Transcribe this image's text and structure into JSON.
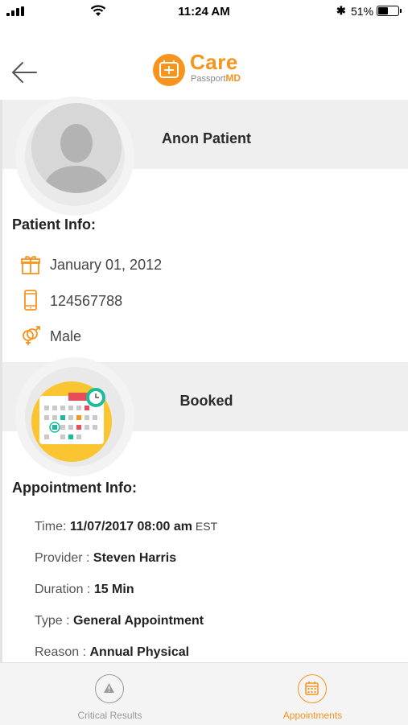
{
  "status_bar": {
    "time": "11:24 AM",
    "battery_percent": "51%",
    "battery_level": 0.51
  },
  "header": {
    "back_icon": "arrow-left-icon",
    "logo": {
      "word": "Care",
      "sub_plain": "Passport",
      "sub_bold": "MD",
      "color": "#f7941d"
    }
  },
  "patient": {
    "name": "Anon Patient",
    "section_title": "Patient Info:",
    "dob": "January 01, 2012",
    "phone": "124567788",
    "gender": "Male"
  },
  "appointment": {
    "status": "Booked",
    "section_title": "Appointment Info:",
    "rows": [
      {
        "label": "Time: ",
        "value": "11/07/2017 08:00 am",
        "suffix": " EST"
      },
      {
        "label": "Provider : ",
        "value": "Steven Harris"
      },
      {
        "label": "Duration : ",
        "value": "15 Min"
      },
      {
        "label": "Type : ",
        "value": "General Appointment"
      },
      {
        "label": "Reason : ",
        "value": "Annual Physical"
      }
    ]
  },
  "tabs": [
    {
      "label": "Critical Results",
      "icon": "warning-icon",
      "active": false
    },
    {
      "label": "Appointments",
      "icon": "calendar-icon",
      "active": true
    }
  ],
  "colors": {
    "accent": "#f7941d",
    "inactive": "#999999",
    "band": "#efefef"
  }
}
